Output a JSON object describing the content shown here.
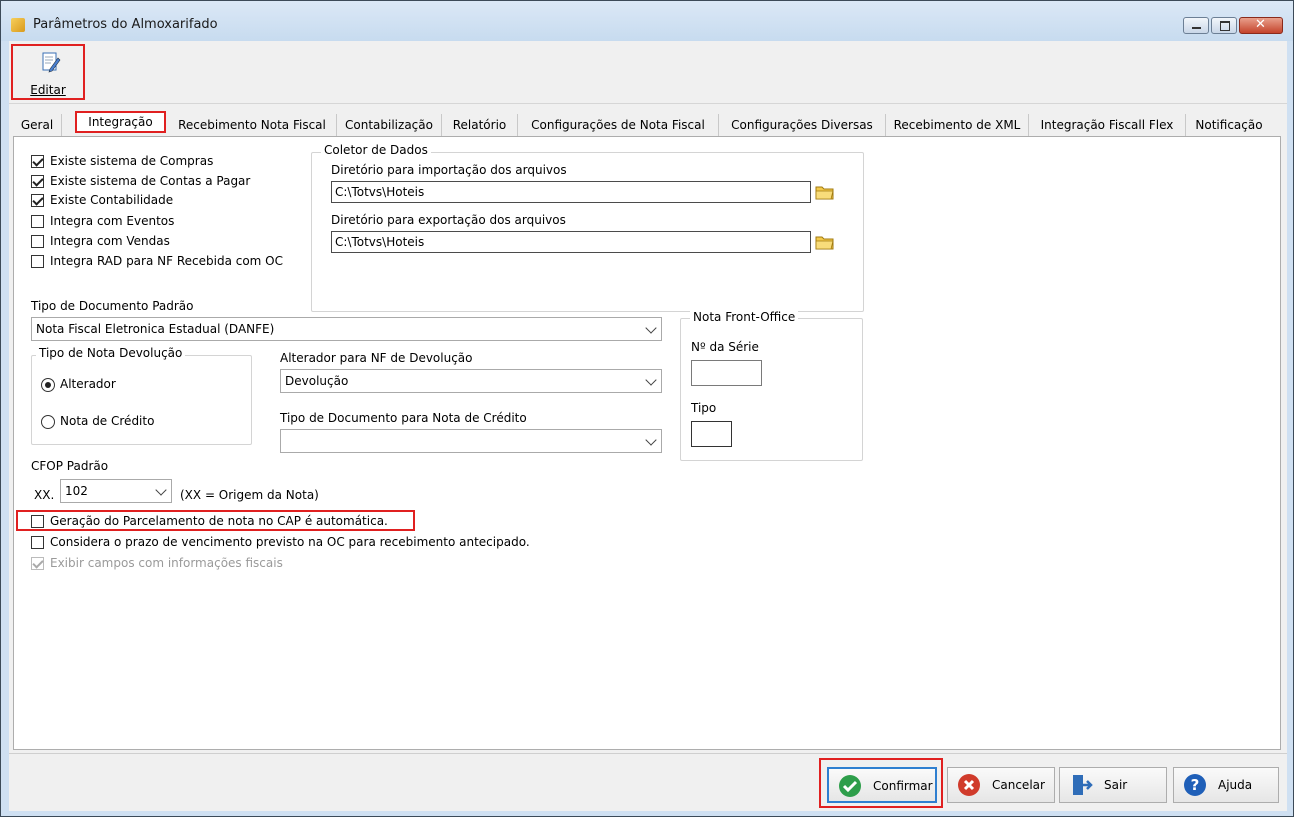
{
  "window": {
    "title": "Parâmetros do Almoxarifado"
  },
  "toolbar": {
    "edit_label": "Editar"
  },
  "tabs": [
    {
      "label": "Geral"
    },
    {
      "label": "Integração"
    },
    {
      "label": "Recebimento Nota Fiscal"
    },
    {
      "label": "Contabilização"
    },
    {
      "label": "Relatório"
    },
    {
      "label": "Configurações de Nota Fiscal"
    },
    {
      "label": "Configurações Diversas"
    },
    {
      "label": "Recebimento de XML"
    },
    {
      "label": "Integração Fiscall Flex"
    },
    {
      "label": "Notificação"
    }
  ],
  "active_tab": "Integração",
  "checkboxes": [
    {
      "label": "Existe sistema de Compras",
      "checked": true
    },
    {
      "label": "Existe sistema de Contas a Pagar",
      "checked": true
    },
    {
      "label": "Existe Contabilidade",
      "checked": true
    },
    {
      "label": "Integra com Eventos",
      "checked": false
    },
    {
      "label": "Integra com Vendas",
      "checked": false
    },
    {
      "label": "Integra RAD para NF Recebida com OC",
      "checked": false
    }
  ],
  "coletor": {
    "title": "Coletor de Dados",
    "import_label": "Diretório para importação dos arquivos",
    "import_value": "C:\\Totvs\\Hoteis",
    "export_label": "Diretório para exportação dos arquivos",
    "export_value": "C:\\Totvs\\Hoteis"
  },
  "tipo_doc": {
    "label": "Tipo de Documento Padrão",
    "value": "Nota Fiscal Eletronica Estadual (DANFE)"
  },
  "tipo_nota_dev": {
    "title": "Tipo de Nota Devolução",
    "opt1": "Alterador",
    "opt2": "Nota de Crédito",
    "selected": "Alterador"
  },
  "alterador": {
    "label": "Alterador para NF de Devolução",
    "value": "Devolução"
  },
  "tipo_doc_credito": {
    "label": "Tipo de Documento para Nota de Crédito",
    "value": ""
  },
  "front_office": {
    "title": "Nota Front-Office",
    "serie_label": "Nº da Série",
    "serie_value": "",
    "tipo_label": "Tipo",
    "tipo_value": ""
  },
  "cfop": {
    "label": "CFOP Padrão",
    "prefix": "XX.",
    "value": "102",
    "note": "(XX = Origem da Nota)"
  },
  "options": [
    {
      "label": "Geração do Parcelamento de nota no CAP é automática.",
      "checked": false
    },
    {
      "label": "Considera o prazo de vencimento previsto na OC para recebimento antecipado.",
      "checked": false
    },
    {
      "label": "Exibir campos com informações fiscais",
      "checked": true
    }
  ],
  "buttons": {
    "confirm": "Confirmar",
    "cancel": "Cancelar",
    "exit": "Sair",
    "help": "Ajuda"
  },
  "colors": {
    "highlight": "#e02020",
    "confirm_green": "#2e9e4b",
    "cancel_red": "#d03b2b",
    "help_blue": "#1f5fb8",
    "exit_blue": "#2f6db8"
  }
}
